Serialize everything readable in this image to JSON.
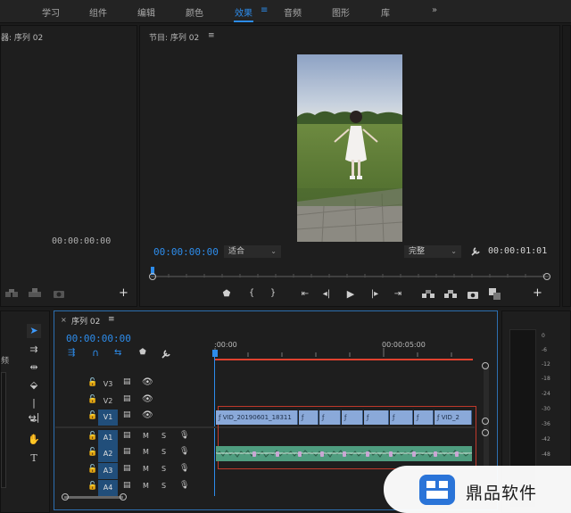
{
  "workspaces": {
    "tabs": [
      "学习",
      "组件",
      "编辑",
      "颜色",
      "效果",
      "音频",
      "图形",
      "库"
    ],
    "active": "效果",
    "menu_glyph": "≡",
    "overflow": "»"
  },
  "source_monitor": {
    "title": "器: 序列 02",
    "timecode": "00:00:00:00"
  },
  "program_monitor": {
    "title": "节目: 序列 02",
    "menu_glyph": "≡",
    "current_time": "00:00:00:00",
    "fit_label": "适合",
    "quality_label": "完整",
    "duration": "00:00:01:01"
  },
  "timeline": {
    "tab_title": "序列 02",
    "current_time": "00:00:00:00",
    "ruler_start": ":00:00",
    "ruler_mid": "00:00:05:00",
    "tracks": [
      {
        "name": "V3",
        "kind": "video"
      },
      {
        "name": "V2",
        "kind": "video"
      },
      {
        "name": "V1",
        "kind": "video"
      },
      {
        "name": "A1",
        "kind": "audio"
      },
      {
        "name": "A2",
        "kind": "audio"
      },
      {
        "name": "A3",
        "kind": "audio"
      },
      {
        "name": "A4",
        "kind": "audio"
      }
    ],
    "clip_name": "VID_20190601_18311",
    "clip_name_end": "VID_2",
    "m_label": "M",
    "s_label": "S"
  },
  "tools_panel": {
    "side_label": "频"
  },
  "meter": {
    "db_labels": [
      "0",
      "-6",
      "-12",
      "-18",
      "-24",
      "-30",
      "-36",
      "-42",
      "-48"
    ]
  },
  "watermark": {
    "text": "鼎品软件"
  },
  "colors": {
    "accent": "#2d8ceb",
    "clip_video": "#8aa9d9",
    "clip_audio": "#4f9d7f",
    "work_area": "#e0412f",
    "selected_track": "#214e7a"
  }
}
